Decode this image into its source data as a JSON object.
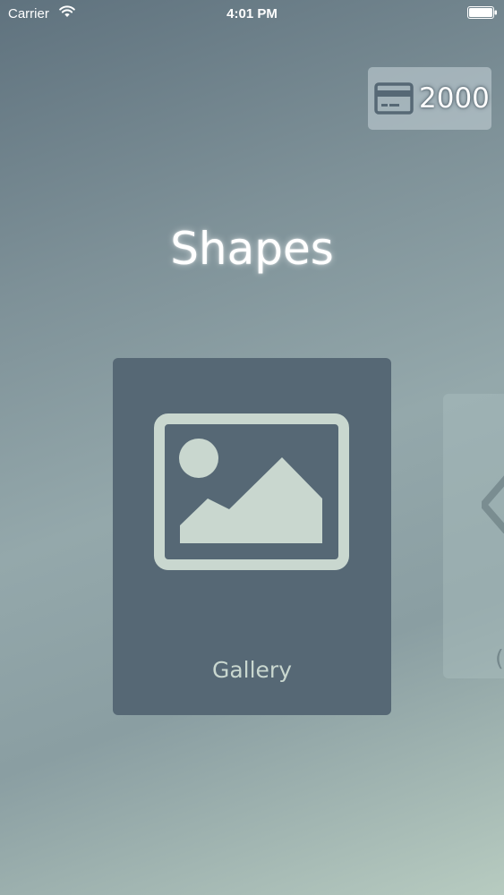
{
  "status_bar": {
    "carrier": "Carrier",
    "time": "4:01 PM"
  },
  "currency": {
    "amount": "2000",
    "icon": "credit-card-icon"
  },
  "title": "Shapes",
  "cards": [
    {
      "label": "Gallery",
      "icon": "image-icon"
    },
    {
      "label": "(",
      "icon": "eye-icon"
    }
  ],
  "colors": {
    "card_bg": "#566875",
    "icon_fill": "#c9d7cf",
    "badge_bg": "#c8d6da"
  }
}
